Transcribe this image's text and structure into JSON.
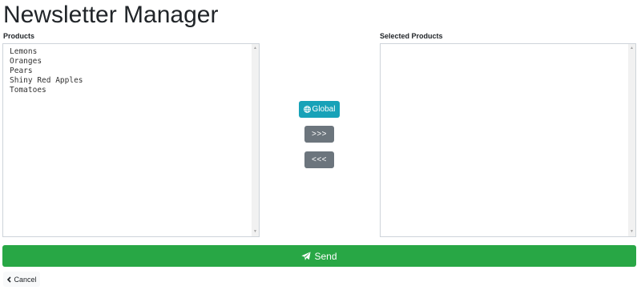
{
  "header": {
    "title": "Newsletter Manager"
  },
  "products": {
    "label": "Products",
    "items": [
      "Lemons",
      "Oranges",
      "Pears",
      "Shiny Red Apples",
      "Tomatoes"
    ]
  },
  "selected_products": {
    "label": "Selected Products",
    "items": []
  },
  "controls": {
    "global_label": "Global",
    "global_icon": "globe-icon",
    "add_label": ">>>",
    "remove_label": "<<<"
  },
  "actions": {
    "send_label": "Send",
    "send_icon": "paper-plane-icon",
    "cancel_label": "Cancel",
    "cancel_icon": "chevron-left-icon"
  },
  "colors": {
    "global_button": "#17a2b8",
    "move_buttons": "#6c757d",
    "send_button": "#28a745",
    "cancel_button": "#f8f9fa"
  }
}
